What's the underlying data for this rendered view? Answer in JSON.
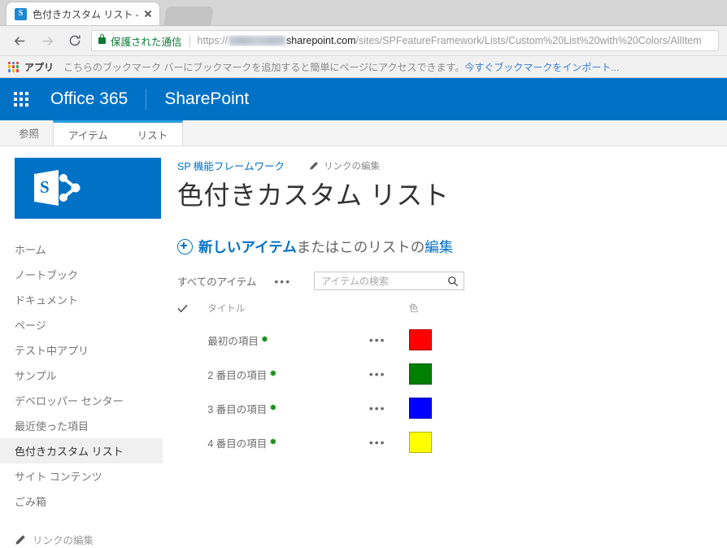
{
  "browser": {
    "tab": {
      "favicon_letter": "S",
      "favicon_name": "sharepoint-favicon",
      "title": "色付きカスタム リスト -"
    },
    "nav": {
      "back": "←",
      "forward": "→",
      "reload": "⟳"
    },
    "omnibox": {
      "secure_label": "保護された通信",
      "scheme": "https://",
      "host": "sharepoint.com",
      "path": "/sites/SPFeatureFramework/Lists/Custom%20List%20with%20Colors/AllItem"
    },
    "bookmarks": {
      "apps_label": "アプリ",
      "message": "こちらのブックマーク バーにブックマークを追加すると簡単にページにアクセスできます。",
      "import_link": "今すぐブックマークをインポート..."
    }
  },
  "suitebar": {
    "waffle_name": "app-launcher-icon",
    "brand": "Office 365",
    "app": "SharePoint",
    "color": "#0072c6"
  },
  "ribbon": {
    "browse_tab": "参照",
    "tabs": [
      {
        "label": "アイテム"
      },
      {
        "label": "リスト"
      }
    ],
    "accent_color": "#2ba0dd"
  },
  "sidebar": {
    "logo_letter": "S",
    "items": [
      {
        "label": "ホーム",
        "selected": false
      },
      {
        "label": "ノートブック",
        "selected": false
      },
      {
        "label": "ドキュメント",
        "selected": false
      },
      {
        "label": "ページ",
        "selected": false
      },
      {
        "label": "テスト中アプリ",
        "selected": false
      },
      {
        "label": "サンプル",
        "selected": false
      },
      {
        "label": "デベロッパー センター",
        "selected": false
      },
      {
        "label": "最近使った項目",
        "selected": false
      },
      {
        "label": "色付きカスタム リスト",
        "selected": true
      },
      {
        "label": "サイト コンテンツ",
        "selected": false
      },
      {
        "label": "ごみ箱",
        "selected": false
      }
    ],
    "edit_links": "リンクの編集"
  },
  "main": {
    "breadcrumb": "SP 機能フレームワーク",
    "edit_links": "リンクの編集",
    "title": "色付きカスタム リスト",
    "new_item": {
      "plus_icon": "plus-circle-icon",
      "strong": "新しいアイテム",
      "middle": "またはこのリストの",
      "edit": "編集"
    },
    "toolbar": {
      "view_name": "すべてのアイテム",
      "more": "•••"
    },
    "search": {
      "placeholder": "アイテムの検索",
      "value": "",
      "icon": "search-icon"
    },
    "table": {
      "columns": [
        {
          "key": "check",
          "label": ""
        },
        {
          "key": "title",
          "label": "タイトル"
        },
        {
          "key": "menu",
          "label": ""
        },
        {
          "key": "color",
          "label": "色"
        }
      ],
      "rows": [
        {
          "title": "最初の項目",
          "new_flag": "✹",
          "menu": "•••",
          "color": "#FF0000"
        },
        {
          "title": "2 番目の項目",
          "new_flag": "✹",
          "menu": "•••",
          "color": "#008000"
        },
        {
          "title": "3 番目の項目",
          "new_flag": "✹",
          "menu": "•••",
          "color": "#0000FF"
        },
        {
          "title": "4 番目の項目",
          "new_flag": "✹",
          "menu": "•••",
          "color": "#FFFF00"
        }
      ]
    }
  }
}
